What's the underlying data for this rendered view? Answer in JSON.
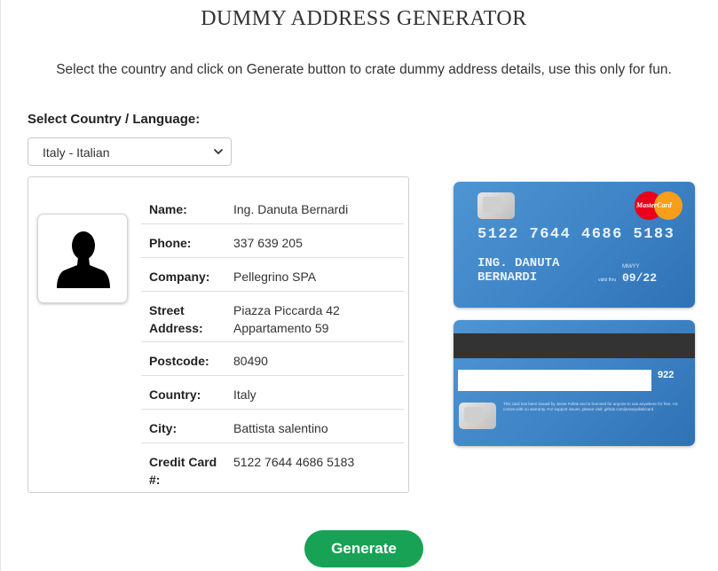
{
  "header": {
    "title": "DUMMY ADDRESS GENERATOR",
    "subtitle": "Select the country and click on Generate button to crate dummy address details, use this only for fun."
  },
  "country_select": {
    "label": "Select Country / Language:",
    "selected": "Italy - Italian"
  },
  "avatar_icon": "person-silhouette-icon",
  "details": [
    {
      "label": "Name:",
      "value": "Ing. Danuta Bernardi"
    },
    {
      "label": "Phone:",
      "value": "337 639 205"
    },
    {
      "label": "Company:",
      "value": "Pellegrino SPA"
    },
    {
      "label": "Street Address:",
      "value": "Piazza Piccarda 42 Appartamento 59"
    },
    {
      "label": "Postcode:",
      "value": "80490"
    },
    {
      "label": "Country:",
      "value": "Italy"
    },
    {
      "label": "City:",
      "value": "Battista salentino"
    },
    {
      "label": "Credit Card #:",
      "value": "5122 7644 4686 5183"
    }
  ],
  "card_front": {
    "brand": "MasterCard",
    "number": "5122 7644 4686 5183",
    "holder": "ING. DANUTA BERNARDI",
    "mmyy_label": "MM/YY",
    "valid_label": "valid thru",
    "expiry": "09/22",
    "color": "#3f85c7"
  },
  "card_back": {
    "cvv": "922",
    "fine_print": "This card has been issued by Jesse Pollak and is licensed for anyone to use anywhere for free. AS comes with no warranty. For support issues, please visit: github.com/jessepollak/card."
  },
  "generate_button": {
    "label": "Generate",
    "color": "#17a255"
  }
}
